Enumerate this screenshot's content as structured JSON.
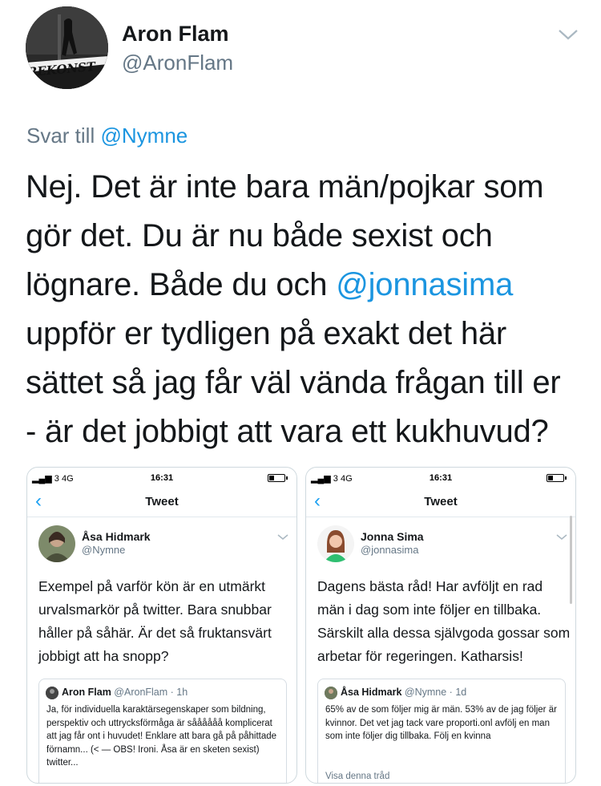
{
  "tweet": {
    "author_name": "Aron Flam",
    "author_handle": "@AronFlam",
    "avatar_overlay_text": "REKONST",
    "reply_prefix": "Svar till",
    "reply_to": "@Nymne",
    "text_part1": "Nej. Det är inte bara män/pojkar som gör det. Du är nu både sexist och lögnare. Både du och ",
    "text_mention": "@jonnasima",
    "text_part2": " uppför er tydligen på exakt det här sättet så jag får väl vända frågan till er - är det jobbigt att vara ett kukhuvud?"
  },
  "screenshots": [
    {
      "signal": "3  4G",
      "time": "16:31",
      "nav_title": "Tweet",
      "author_name": "Åsa Hidmark",
      "author_handle": "@Nymne",
      "text": "Exempel på varför kön är en utmärkt urvalsmarkör på twitter. Bara snubbar håller på såhär. Är det så fruktansvärt jobbigt att ha snopp?",
      "quote": {
        "name": "Aron Flam",
        "meta": "@AronFlam · 1h",
        "text": "Ja, för individuella karaktärsegenskaper som bildning, perspektiv och uttrycksförmåga är såååååå komplicerat att jag får ont i huvudet! Enklare att bara gå på påhittade förnamn... (< — OBS! Ironi. Åsa är en sketen sexist) twitter..."
      }
    },
    {
      "signal": "3  4G",
      "time": "16:31",
      "nav_title": "Tweet",
      "author_name": "Jonna Sima",
      "author_handle": "@jonnasima",
      "text": "Dagens bästa råd! Har avföljt en rad män i dag som inte följer en tillbaka. Särskilt alla dessa självgoda gossar som arbetar för regeringen. Katharsis!",
      "quote": {
        "name": "Åsa Hidmark",
        "meta": "@Nymne · 1d",
        "text": "65% av de som följer mig är män. 53% av de jag följer är kvinnor. Det vet jag tack vare proporti.onl avfölj en man som inte följer dig tillbaka. Följ en kvinna",
        "link": "Visa denna tråd"
      }
    }
  ],
  "colors": {
    "link": "#1b95e0",
    "secondary_text": "#657786",
    "ios_accent": "#1da1f2"
  }
}
